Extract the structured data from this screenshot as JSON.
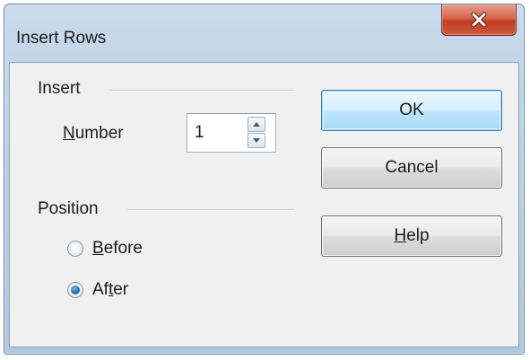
{
  "dialog": {
    "title": "Insert Rows",
    "close_icon": "close-x-icon"
  },
  "insert_group": {
    "label": "Insert",
    "number_label_mnemonic": "N",
    "number_label_rest": "umber",
    "number_value": "1",
    "spin_up_icon": "arrow-up-icon",
    "spin_down_icon": "arrow-down-icon"
  },
  "position_group": {
    "label": "Position",
    "options": [
      {
        "mnemonic": "B",
        "rest": "efore",
        "selected": false
      },
      {
        "mnemonic": "t",
        "prefix": "Af",
        "rest": "er",
        "selected": true
      }
    ]
  },
  "buttons": {
    "ok": "OK",
    "cancel": "Cancel",
    "help_mnemonic": "H",
    "help_rest": "elp"
  },
  "colors": {
    "title_bar": "#b9cfe5",
    "close_button": "#c1391d",
    "default_button_border": "#3c7fb1",
    "radio_selected": "#2f6eb0"
  }
}
